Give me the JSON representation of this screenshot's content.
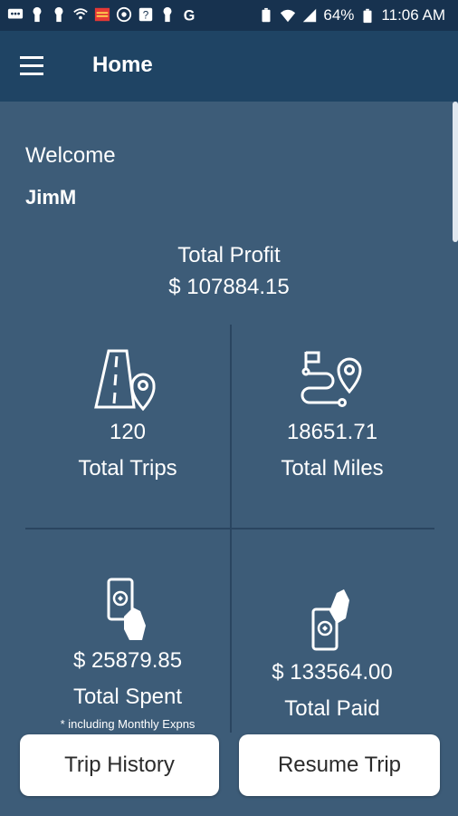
{
  "status_bar": {
    "battery": "64%",
    "time": "11:06 AM",
    "left_icons": [
      "message-icon",
      "keyhole-icon",
      "keyhole-icon",
      "wifi-calling-icon",
      "red-app-icon",
      "gear-badge-icon",
      "help-icon",
      "keyhole-icon",
      "google-g-icon"
    ],
    "right_icons": [
      "battery-saver-icon",
      "wifi-icon",
      "signal-icon",
      "battery-icon"
    ]
  },
  "appbar": {
    "title": "Home"
  },
  "welcome": {
    "greeting": "Welcome",
    "username": "JimM"
  },
  "profit": {
    "label": "Total Profit",
    "value": "$ 107884.15"
  },
  "stats": {
    "trips": {
      "value": "120",
      "label": "Total Trips"
    },
    "miles": {
      "value": "18651.71",
      "label": "Total Miles"
    },
    "spent": {
      "value": "$ 25879.85",
      "label": "Total Spent",
      "note": "* including Monthly Expns"
    },
    "paid": {
      "value": "$ 133564.00",
      "label": "Total Paid"
    }
  },
  "buttons": {
    "trip_history": "Trip History",
    "resume_trip": "Resume Trip"
  }
}
